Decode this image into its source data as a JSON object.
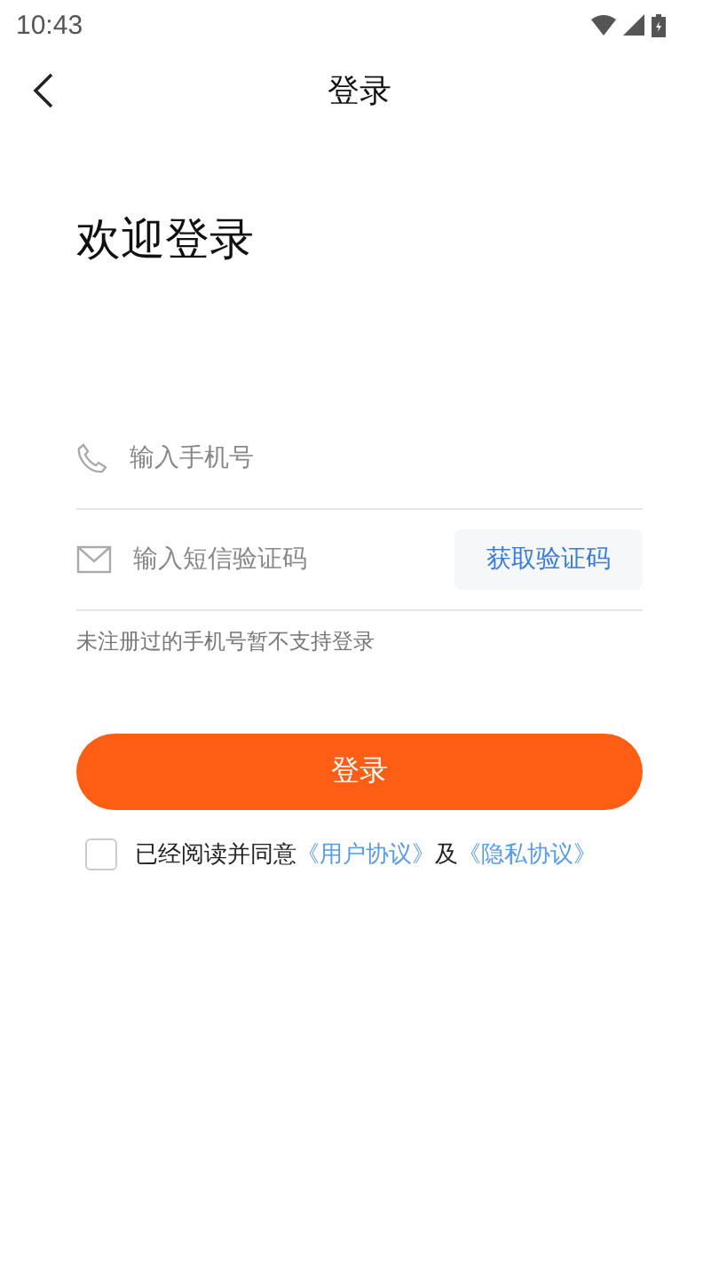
{
  "status_bar": {
    "time": "10:43"
  },
  "header": {
    "title": "登录"
  },
  "welcome": "欢迎登录",
  "phone_field": {
    "placeholder": "输入手机号"
  },
  "code_field": {
    "placeholder": "输入短信验证码"
  },
  "get_code_button": "获取验证码",
  "hint": "未注册过的手机号暂不支持登录",
  "login_button": "登录",
  "agreement": {
    "checked": false,
    "prefix": "已经阅读并同意",
    "link_1": "《用户协议》",
    "joiner": "及",
    "link_2": "《隐私协议》"
  }
}
